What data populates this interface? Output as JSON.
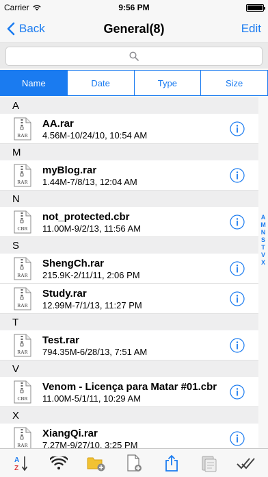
{
  "status_bar": {
    "carrier": "Carrier",
    "time": "9:56 PM",
    "battery_level": 1.0
  },
  "nav": {
    "back_label": "Back",
    "title": "General(8)",
    "edit_label": "Edit"
  },
  "search": {
    "placeholder": ""
  },
  "sort_tabs": [
    {
      "label": "Name",
      "selected": true
    },
    {
      "label": "Date",
      "selected": false
    },
    {
      "label": "Type",
      "selected": false
    },
    {
      "label": "Size",
      "selected": false
    }
  ],
  "sections": [
    {
      "letter": "A",
      "files": [
        {
          "name": "AA.rar",
          "details": "4.56M-10/24/10, 10:54 AM",
          "type": "RAR"
        }
      ]
    },
    {
      "letter": "M",
      "files": [
        {
          "name": "myBlog.rar",
          "details": "1.44M-7/8/13, 12:04 AM",
          "type": "RAR"
        }
      ]
    },
    {
      "letter": "N",
      "files": [
        {
          "name": "not_protected.cbr",
          "details": "11.00M-9/2/13, 11:56 AM",
          "type": "CBR"
        }
      ]
    },
    {
      "letter": "S",
      "files": [
        {
          "name": "ShengCh.rar",
          "details": "215.9K-2/11/11, 2:06 PM",
          "type": "RAR"
        },
        {
          "name": "Study.rar",
          "details": "12.99M-7/1/13, 11:27 PM",
          "type": "RAR"
        }
      ]
    },
    {
      "letter": "T",
      "files": [
        {
          "name": "Test.rar",
          "details": "794.35M-6/28/13, 7:51 AM",
          "type": "RAR"
        }
      ]
    },
    {
      "letter": "V",
      "files": [
        {
          "name": "Venom - Licença para Matar #01.cbr",
          "details": "11.00M-5/1/11, 10:29 AM",
          "type": "CBR"
        }
      ]
    },
    {
      "letter": "X",
      "files": [
        {
          "name": "XiangQi.rar",
          "details": "7.27M-9/27/10, 3:25 PM",
          "type": "RAR"
        }
      ]
    }
  ],
  "index": [
    "A",
    "M",
    "N",
    "S",
    "T",
    "V",
    "X"
  ],
  "toolbar": [
    {
      "name": "sort-az-icon"
    },
    {
      "name": "wifi-icon"
    },
    {
      "name": "add-folder-icon"
    },
    {
      "name": "new-file-icon"
    },
    {
      "name": "share-icon"
    },
    {
      "name": "paste-icon"
    },
    {
      "name": "select-all-icon"
    }
  ],
  "colors": {
    "accent": "#1a7bf0",
    "header_bg": "#eeeeef"
  }
}
